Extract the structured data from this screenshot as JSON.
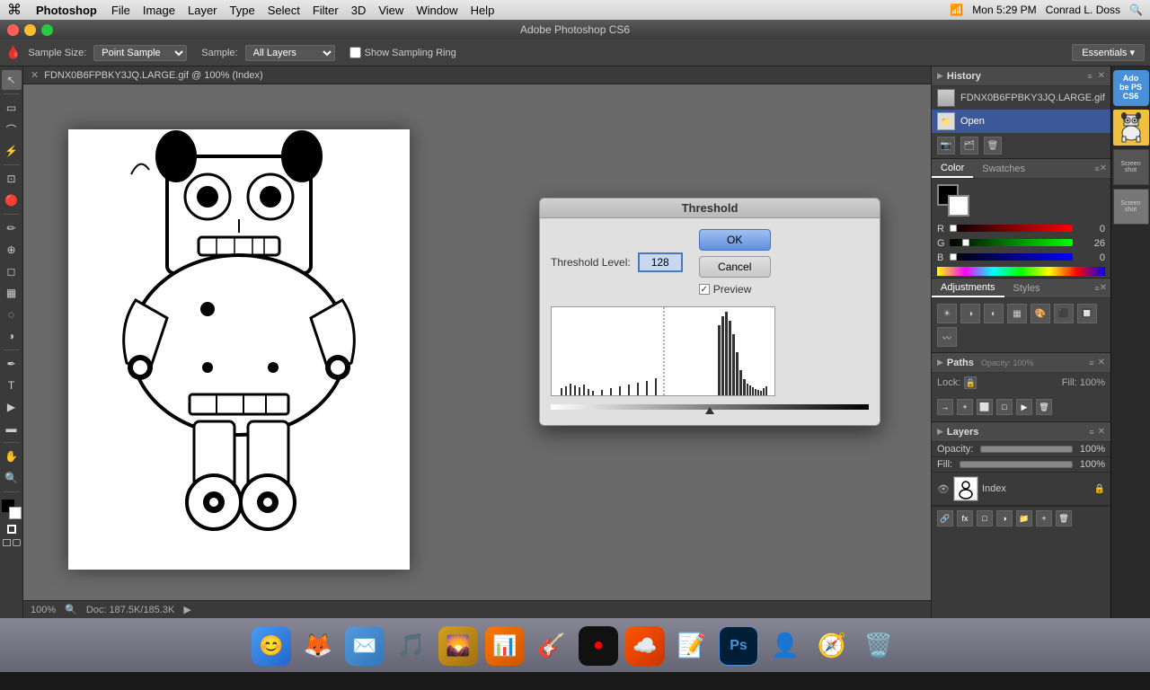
{
  "menubar": {
    "apple": "⌘",
    "app": "Photoshop",
    "menus": [
      "File",
      "Image",
      "Layer",
      "Type",
      "Select",
      "Filter",
      "3D",
      "View",
      "Window",
      "Help"
    ],
    "right": "Mon 5:29 PM  Conrad L. Doss",
    "wifi_icon": "wifi",
    "time": "Mon 5:29 PM"
  },
  "titlebar": {
    "title": "Adobe Photoshop CS6"
  },
  "toolbar": {
    "eyedropper_icon": "eyedropper",
    "sample_size_label": "Sample Size:",
    "sample_size_value": "Point Sample",
    "sample_label": "Sample:",
    "sample_value": "All Layers",
    "show_ring_label": "Show Sampling Ring",
    "essentials_label": "Essentials ▾"
  },
  "document": {
    "tab_title": "FDNX0B6FPBKY3JQ.LARGE.gif @ 100% (Index)"
  },
  "status_bar": {
    "zoom": "100%",
    "doc_size": "Doc: 187.5K/185.3K"
  },
  "history": {
    "panel_title": "History",
    "item": "FDNX0B6FPBKY3JQ.LARGE.gif",
    "sub_item": "Open"
  },
  "color_panel": {
    "title": "Color",
    "swatches_title": "Swatches",
    "r_label": "R",
    "r_value": "0",
    "g_label": "G",
    "g_value": "26",
    "b_label": "B",
    "b_value": "0"
  },
  "adjustments_panel": {
    "title": "Adjustments",
    "styles_title": "Styles"
  },
  "paths_panel": {
    "title": "Paths"
  },
  "layers": {
    "panel_title": "Layers",
    "opacity_label": "Opacity:",
    "opacity_value": "100%",
    "fill_label": "Fill:",
    "fill_value": "100%",
    "lock_label": "Lock:",
    "layer_name": "Index"
  },
  "threshold_dialog": {
    "title": "Threshold",
    "level_label": "Threshold Level:",
    "level_value": "128",
    "ok_label": "OK",
    "cancel_label": "Cancel",
    "preview_label": "Preview",
    "preview_checked": true
  },
  "sidebar_right": {
    "ps_label": "Adobe Photoshop CS6",
    "thumbnail_robot": "robot image"
  },
  "dock_items": [
    {
      "id": "finder",
      "label": "Finder",
      "color": "#4a9af5",
      "symbol": "🔵"
    },
    {
      "id": "firefox",
      "label": "Firefox",
      "color": "#e86022",
      "symbol": "🦊"
    },
    {
      "id": "mail2",
      "label": "Mail",
      "color": "#5599dd",
      "symbol": "✉"
    },
    {
      "id": "itunes",
      "label": "iTunes",
      "color": "#ff2d55",
      "symbol": "🎵"
    },
    {
      "id": "iphoto",
      "label": "iPhoto",
      "color": "#daa520",
      "symbol": "🌄"
    },
    {
      "id": "keynote",
      "label": "Keynote",
      "color": "#ff6600",
      "symbol": "📊"
    },
    {
      "id": "guitar",
      "label": "GarageBand",
      "color": "#333",
      "symbol": "🎸"
    },
    {
      "id": "backlive",
      "label": "BackBlaze",
      "color": "#333",
      "symbol": "🔴"
    },
    {
      "id": "soundcloud",
      "label": "SoundCloud",
      "color": "#ff5500",
      "symbol": "☁"
    },
    {
      "id": "notesapp",
      "label": "Notes",
      "color": "#ffd700",
      "symbol": "📝"
    },
    {
      "id": "photoshop",
      "label": "Photoshop",
      "color": "#001e36",
      "symbol": "Ps"
    },
    {
      "id": "contacts",
      "label": "Contacts",
      "color": "#aaa",
      "symbol": "👤"
    },
    {
      "id": "safari",
      "label": "Safari",
      "color": "#4a90d9",
      "symbol": "🧭"
    },
    {
      "id": "trash",
      "label": "Trash",
      "color": "#888",
      "symbol": "🗑"
    }
  ]
}
